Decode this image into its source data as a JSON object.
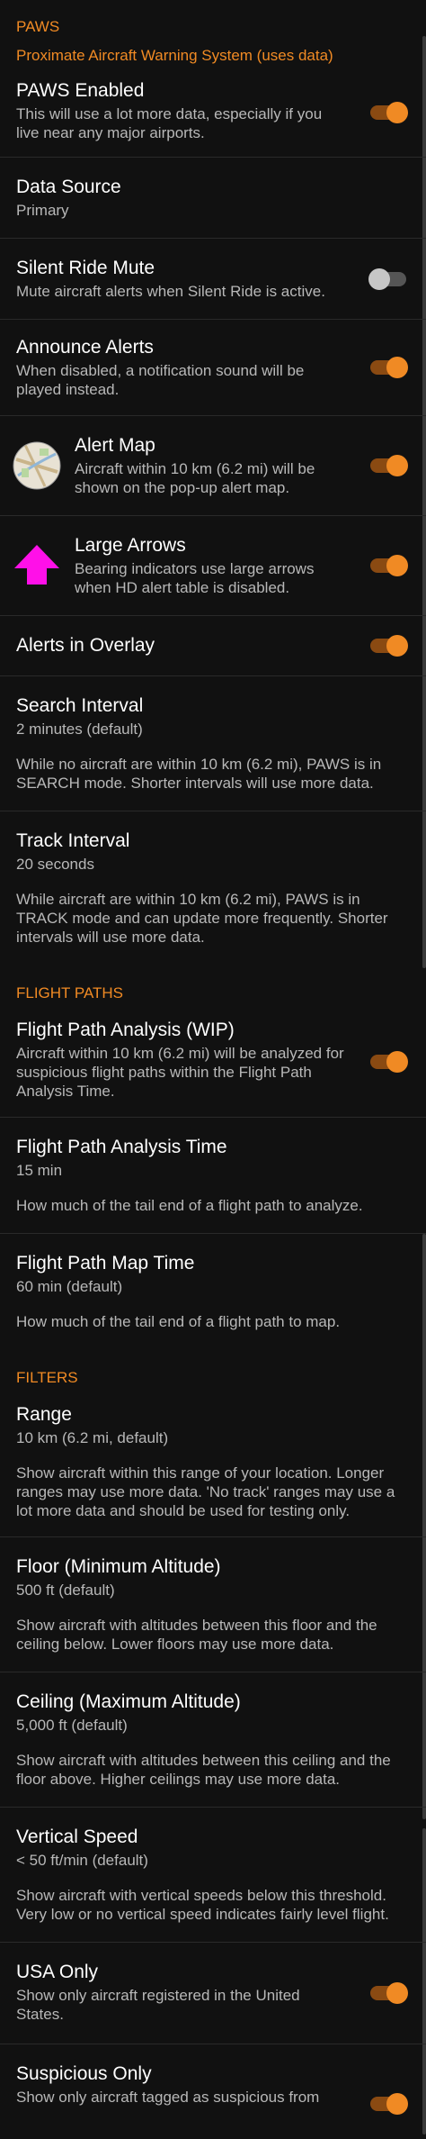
{
  "paws": {
    "header": "PAWS",
    "subtitle": "Proximate Aircraft Warning System (uses data)",
    "enabled": {
      "title": "PAWS Enabled",
      "desc": "This will use a lot more data, especially if you live near any major airports.",
      "on": true
    },
    "data_source": {
      "title": "Data Source",
      "value": "Primary"
    },
    "silent_ride": {
      "title": "Silent Ride Mute",
      "desc": "Mute aircraft alerts when Silent Ride is active.",
      "on": false
    },
    "announce": {
      "title": "Announce Alerts",
      "desc": "When disabled, a notification sound will be played instead.",
      "on": true
    },
    "alert_map": {
      "title": "Alert Map",
      "desc": "Aircraft within 10 km (6.2 mi) will be shown on the pop-up alert map.",
      "icon": "map-icon",
      "on": true
    },
    "large_arrows": {
      "title": "Large Arrows",
      "desc": "Bearing indicators use large arrows when HD alert table is disabled.",
      "icon": "up-arrow-icon",
      "on": true
    },
    "overlay": {
      "title": "Alerts in Overlay",
      "on": true
    },
    "search_interval": {
      "title": "Search Interval",
      "value": "2 minutes (default)",
      "desc": "While no aircraft are within 10 km (6.2 mi), PAWS is in SEARCH mode.  Shorter intervals will use more data."
    },
    "track_interval": {
      "title": "Track Interval",
      "value": "20 seconds",
      "desc": "While aircraft are within 10 km (6.2 mi), PAWS is in TRACK mode and can update more frequently.  Shorter intervals will use more data."
    }
  },
  "flight_paths": {
    "header": "FLIGHT PATHS",
    "analysis": {
      "title": "Flight Path Analysis (WIP)",
      "desc": "Aircraft within 10 km (6.2 mi) will be analyzed for suspicious flight paths within the Flight Path Analysis Time.",
      "on": true
    },
    "analysis_time": {
      "title": "Flight Path Analysis Time",
      "value": "15 min",
      "desc": "How much of the tail end of a flight path to analyze."
    },
    "map_time": {
      "title": "Flight Path Map Time",
      "value": "60 min (default)",
      "desc": "How much of the tail end of a flight path to map."
    }
  },
  "filters": {
    "header": "FILTERS",
    "range": {
      "title": "Range",
      "value": "10 km (6.2 mi, default)",
      "desc": "Show aircraft within this range of your location.  Longer ranges may use more data.  'No track' ranges may use a lot more data and should be used for testing only."
    },
    "floor": {
      "title": "Floor (Minimum Altitude)",
      "value": "500 ft (default)",
      "desc": "Show aircraft with altitudes between this floor and the ceiling below.  Lower floors may use more data."
    },
    "ceiling": {
      "title": "Ceiling (Maximum Altitude)",
      "value": "5,000 ft (default)",
      "desc": "Show aircraft with altitudes between this ceiling and the floor above.  Higher ceilings may use more data."
    },
    "vertical_speed": {
      "title": "Vertical Speed",
      "value": "< 50 ft/min (default)",
      "desc": "Show aircraft with vertical speeds below this threshold.  Very low or no vertical speed indicates fairly level flight."
    },
    "usa_only": {
      "title": "USA Only",
      "desc": "Show only aircraft registered in the United States.",
      "on": true
    },
    "suspicious_only": {
      "title": "Suspicious Only",
      "desc": "Show only aircraft tagged as suspicious from",
      "on": true
    }
  },
  "colors": {
    "accent": "#f08a24",
    "background": "#111111",
    "divider": "#2a2a2a",
    "secondary_text": "#b8b8b8"
  }
}
